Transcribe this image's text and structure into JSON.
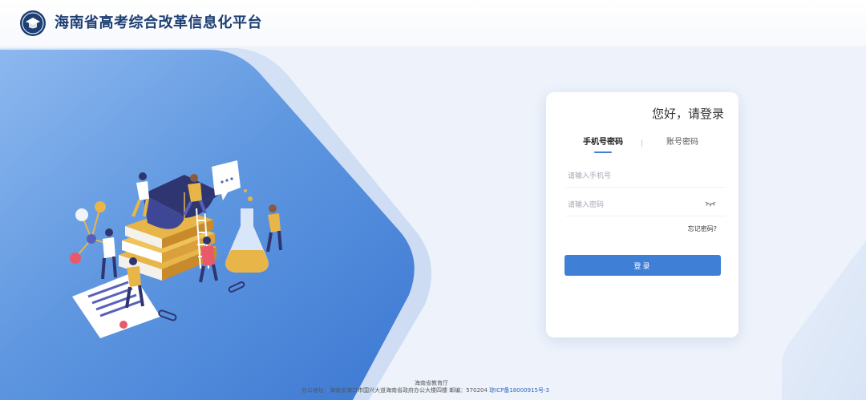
{
  "header": {
    "title": "海南省高考综合改革信息化平台",
    "logo_icon": "education-emblem-icon"
  },
  "illustration": {
    "icons": [
      "graduation-cap-icon",
      "books-stack-icon",
      "flask-icon",
      "molecule-icon",
      "speech-bubble-icon",
      "document-icon",
      "paperclip-icon",
      "student-figure-icon"
    ]
  },
  "login": {
    "greeting": "您好，请登录",
    "tabs": [
      {
        "label": "手机号密码",
        "active": true
      },
      {
        "label": "账号密码",
        "active": false
      }
    ],
    "phone_placeholder": "请输入手机号",
    "password_placeholder": "请输入密码",
    "password_toggle_icon": "eye-closed-icon",
    "forgot_label": "忘记密码?",
    "submit_label": "登录"
  },
  "footer": {
    "org": "海南省教育厅",
    "address": "办公地址：海南省海口市国兴大道海南省政府办公大楼四楼 邮编：570204 ",
    "icp": "琼ICP备18000915号-3"
  },
  "colors": {
    "primary": "#3f7fd6",
    "title": "#1d3f73",
    "background": "#eef3fb",
    "panel": "#4a86d8"
  }
}
